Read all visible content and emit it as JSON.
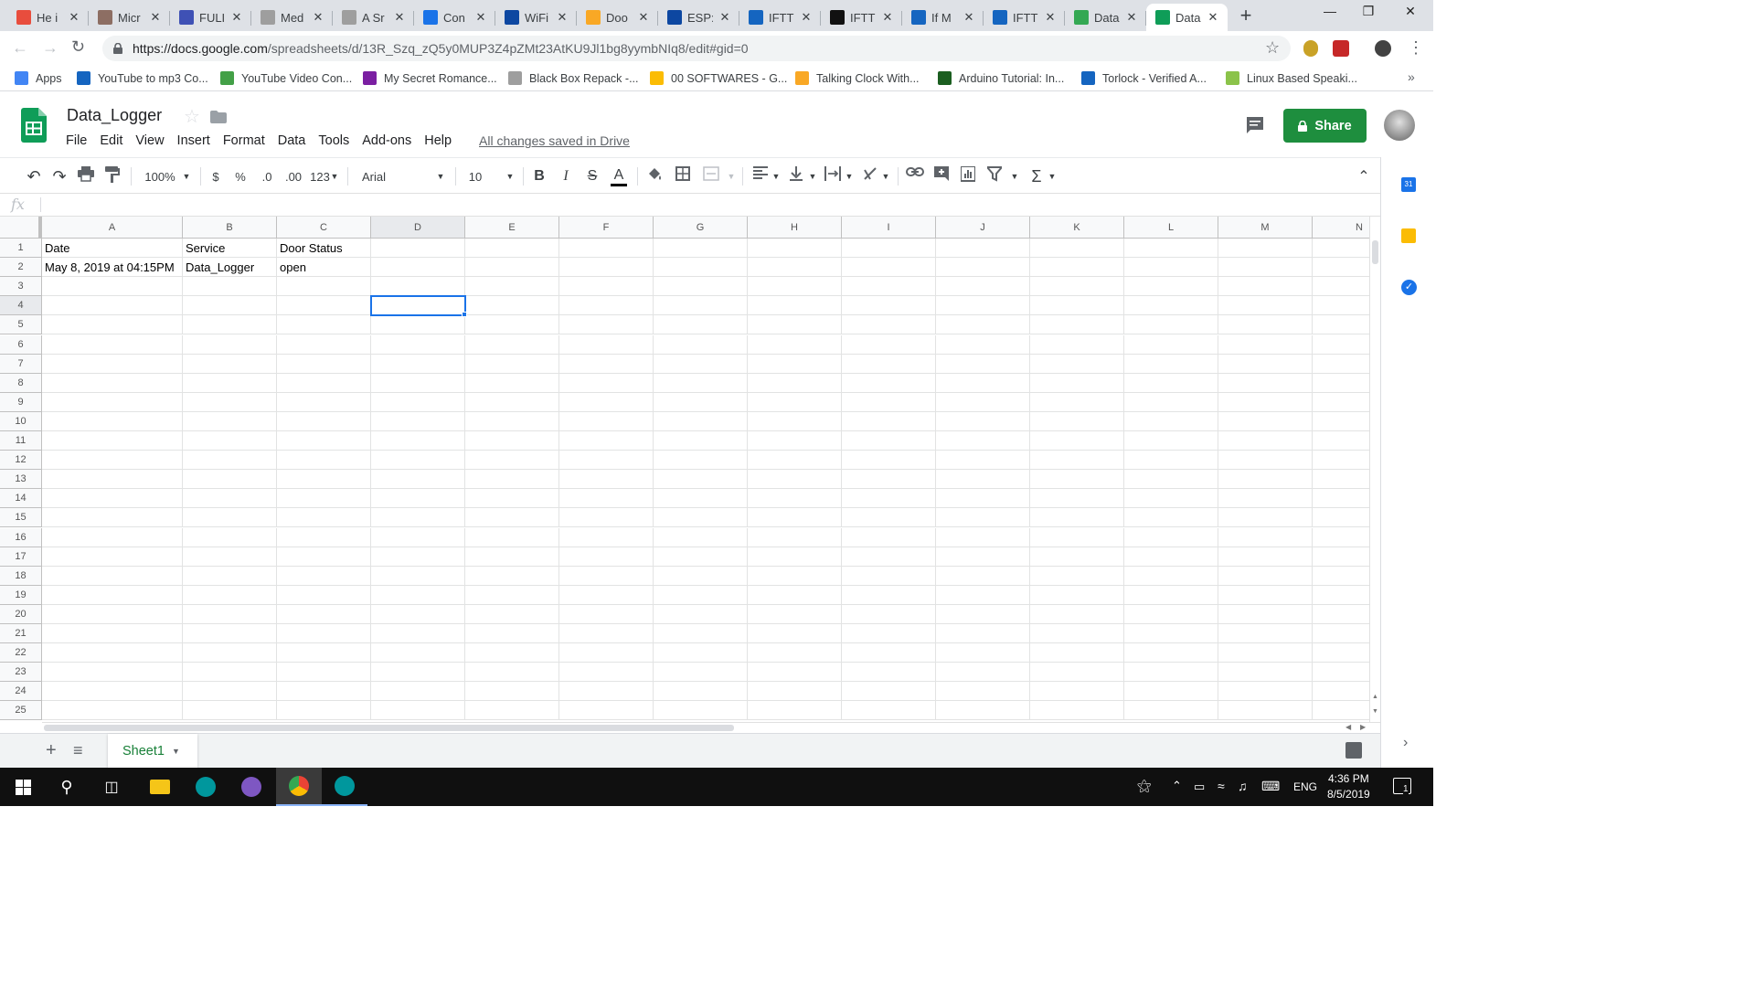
{
  "browser": {
    "tabs": [
      {
        "title": "He i",
        "color": "#e84d3d",
        "active": false
      },
      {
        "title": "Micr",
        "color": "#8d6e63",
        "active": false
      },
      {
        "title": "FULI",
        "color": "#3f51b5",
        "active": false
      },
      {
        "title": "Med",
        "color": "#9e9e9e",
        "active": false
      },
      {
        "title": "A Sr",
        "color": "#9e9e9e",
        "active": false
      },
      {
        "title": "Con",
        "color": "#1a73e8",
        "active": false
      },
      {
        "title": "WiFi",
        "color": "#0d47a1",
        "active": false
      },
      {
        "title": "Doo",
        "color": "#f9a825",
        "active": false
      },
      {
        "title": "ESP:",
        "color": "#0d47a1",
        "active": false
      },
      {
        "title": "IFTT",
        "color": "#1565c0",
        "active": false
      },
      {
        "title": "IFTT",
        "color": "#111111",
        "active": false
      },
      {
        "title": "If M",
        "color": "#1565c0",
        "active": false
      },
      {
        "title": "IFTT",
        "color": "#1565c0",
        "active": false
      },
      {
        "title": "Data",
        "color": "#34a853",
        "active": false
      },
      {
        "title": "Data",
        "color": "#0f9d58",
        "active": true
      }
    ],
    "new_tab": "+",
    "url_host": "https://docs.google.com",
    "url_path": "/spreadsheets/d/13R_Szq_zQ5y0MUP3Z4pZMt23AtKU9Jl1bg8yymbNIq8/edit#gid=0",
    "bookmarks": [
      {
        "label": "Apps",
        "color": "#4285f4"
      },
      {
        "label": "YouTube to mp3 Co...",
        "color": "#1565c0"
      },
      {
        "label": "YouTube Video Con...",
        "color": "#43a047"
      },
      {
        "label": "My Secret Romance...",
        "color": "#7b1fa2"
      },
      {
        "label": "Black Box Repack -...",
        "color": "#9e9e9e"
      },
      {
        "label": "00 SOFTWARES - G...",
        "color": "#fbbc04"
      },
      {
        "label": "Talking Clock With...",
        "color": "#f9a825"
      },
      {
        "label": "Arduino Tutorial: In...",
        "color": "#1b5e20"
      },
      {
        "label": "Torlock - Verified A...",
        "color": "#1565c0"
      },
      {
        "label": "Linux Based Speaki...",
        "color": "#8bc34a"
      }
    ],
    "bookmarks_more": "»"
  },
  "sheets": {
    "title": "Data_Logger",
    "menu": [
      "File",
      "Edit",
      "View",
      "Insert",
      "Format",
      "Data",
      "Tools",
      "Add-ons",
      "Help"
    ],
    "save_status": "All changes saved in Drive",
    "share_label": "Share",
    "toolbar": {
      "zoom": "100%",
      "currency": "$",
      "percent": "%",
      "dec_less": ".0",
      "dec_more": ".00",
      "more_formats": "123",
      "font": "Arial",
      "font_size": "10",
      "bold": "B",
      "italic": "I",
      "strike": "S",
      "text_color": "A"
    },
    "formula_label": "fx",
    "columns": [
      "A",
      "B",
      "C",
      "D",
      "E",
      "F",
      "G",
      "H",
      "I",
      "J",
      "K",
      "L",
      "M",
      "N"
    ],
    "rows": [
      [
        "Date",
        "Service",
        "Door Status"
      ],
      [
        "May 8, 2019 at 04:15PM",
        "Data_Logger",
        "open"
      ]
    ],
    "row_count": 25,
    "active_cell": "D4",
    "sheet_tab": "Sheet1",
    "accent": "#1e8e3e",
    "selection_color": "#1a73e8"
  },
  "taskbar": {
    "lang": "ENG",
    "time": "4:36 PM",
    "date": "8/5/2019",
    "notifications": "1"
  }
}
